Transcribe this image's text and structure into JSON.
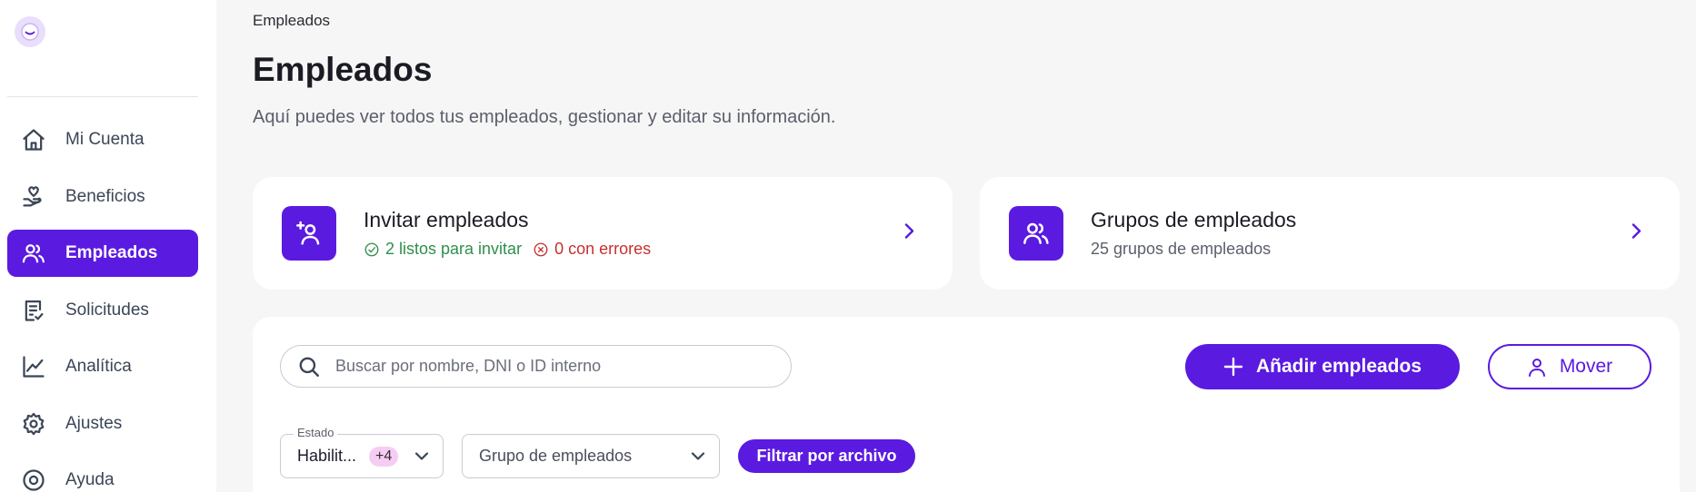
{
  "sidebar": {
    "items": [
      {
        "label": "Mi Cuenta",
        "icon": "home-icon",
        "active": false
      },
      {
        "label": "Beneficios",
        "icon": "hand-heart-icon",
        "active": false
      },
      {
        "label": "Empleados",
        "icon": "users-icon",
        "active": true
      },
      {
        "label": "Solicitudes",
        "icon": "document-check-icon",
        "active": false
      },
      {
        "label": "Analítica",
        "icon": "chart-line-icon",
        "active": false
      },
      {
        "label": "Ajustes",
        "icon": "gear-icon",
        "active": false
      },
      {
        "label": "Ayuda",
        "icon": "help-icon",
        "active": false
      }
    ]
  },
  "header": {
    "breadcrumb": "Empleados",
    "title": "Empleados",
    "subtitle": "Aquí puedes ver todos tus empleados, gestionar y editar su información."
  },
  "cards": {
    "invite": {
      "title": "Invitar empleados",
      "ready": "2 listos para invitar",
      "errors": "0 con errores"
    },
    "groups": {
      "title": "Grupos de empleados",
      "subtitle": "25 grupos de empleados"
    }
  },
  "toolbar": {
    "search_placeholder": "Buscar por nombre, DNI o ID interno",
    "add_label": "Añadir empleados",
    "move_label": "Mover"
  },
  "filters": {
    "estado_label": "Estado",
    "estado_value": "Habilit...",
    "estado_extra": "+4",
    "grupo_placeholder": "Grupo de empleados",
    "file_filter_label": "Filtrar por archivo"
  },
  "colors": {
    "accent": "#5a1ae0",
    "success": "#2f8f4c",
    "error": "#c5312f",
    "chip": "#f6cdf2"
  }
}
